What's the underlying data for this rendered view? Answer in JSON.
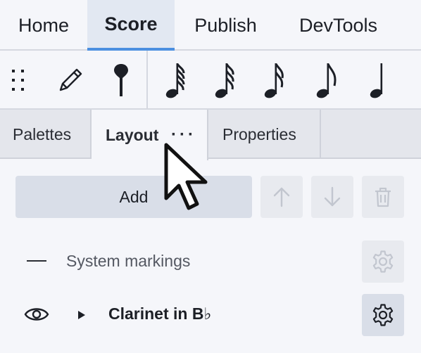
{
  "menubar": {
    "tabs": [
      {
        "label": "Home"
      },
      {
        "label": "Score"
      },
      {
        "label": "Publish"
      },
      {
        "label": "DevTools"
      }
    ],
    "active": "Score",
    "accent_color": "#4b8fe0"
  },
  "toolbar": {
    "tools": [
      "drag-handle-icon",
      "pencil-icon",
      "pin-icon",
      "sixty-fourth-note-icon",
      "thirty-second-note-icon",
      "sixteenth-note-icon",
      "eighth-note-icon",
      "quarter-note-icon"
    ]
  },
  "panel_tabs": {
    "tabs": [
      {
        "label": "Palettes"
      },
      {
        "label": "Layout"
      },
      {
        "label": "Properties"
      }
    ],
    "active": "Layout",
    "more_label": "···"
  },
  "layout_panel": {
    "add_label": "Add",
    "rows": [
      {
        "label": "System markings"
      },
      {
        "label": "Clarinet in B♭"
      }
    ]
  }
}
